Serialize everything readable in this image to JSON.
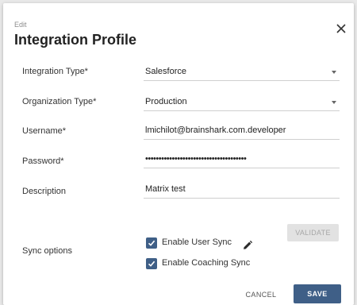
{
  "dialog": {
    "overline": "Edit",
    "title": "Integration Profile"
  },
  "form": {
    "integration_type": {
      "label": "Integration Type*",
      "value": "Salesforce"
    },
    "organization_type": {
      "label": "Organization Type*",
      "value": "Production"
    },
    "username": {
      "label": "Username*",
      "value": "lmichilot@brainshark.com.developer"
    },
    "password": {
      "label": "Password*",
      "value": "••••••••••••••••••••••••••••••••••••••"
    },
    "description": {
      "label": "Description",
      "value": "Matrix test"
    },
    "sync_options": {
      "label": "Sync options",
      "validate_label": "VALIDATE",
      "user_sync_label": "Enable User Sync",
      "coaching_sync_label": "Enable Coaching Sync",
      "user_sync_checked": true,
      "coaching_sync_checked": true
    }
  },
  "actions": {
    "cancel_label": "CANCEL",
    "save_label": "SAVE"
  },
  "icons": {
    "close": "close-icon",
    "pencil": "pencil-icon",
    "dropdown": "chevron-down-icon",
    "check": "check-icon"
  },
  "colors": {
    "primary": "#3f5f87",
    "disabled_button": "#e2e2e2",
    "disabled_text": "#a7a7a7"
  }
}
